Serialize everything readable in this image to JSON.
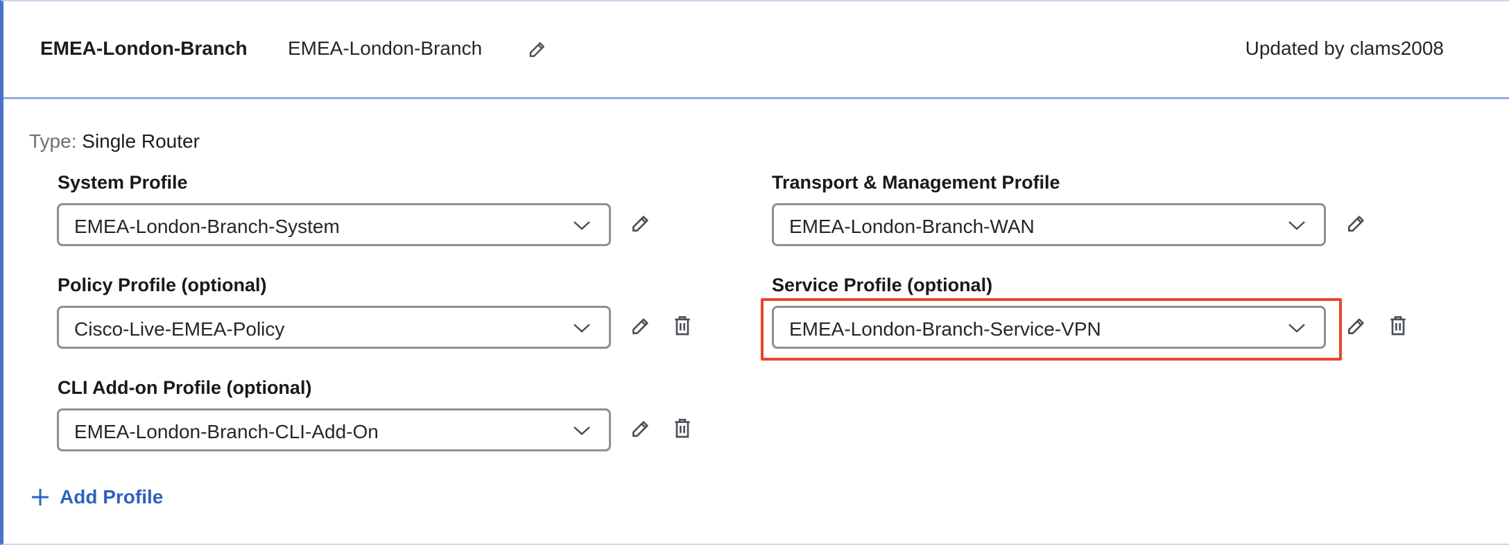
{
  "header": {
    "title": "EMEA-London-Branch",
    "name_value": "EMEA-London-Branch",
    "updated_by": "Updated by clams2008"
  },
  "type": {
    "label": "Type:",
    "value": "Single Router"
  },
  "profiles": {
    "system": {
      "label": "System Profile",
      "value": "EMEA-London-Branch-System"
    },
    "transport": {
      "label": "Transport & Management Profile",
      "value": "EMEA-London-Branch-WAN"
    },
    "policy": {
      "label": "Policy Profile (optional)",
      "value": "Cisco-Live-EMEA-Policy"
    },
    "service": {
      "label": "Service Profile (optional)",
      "value": "EMEA-London-Branch-Service-VPN"
    },
    "cli": {
      "label": "CLI Add-on Profile (optional)",
      "value": "EMEA-London-Branch-CLI-Add-On"
    }
  },
  "actions": {
    "add_profile": "Add Profile"
  },
  "colors": {
    "accent": "#2f61c4",
    "highlight": "#e8452c",
    "border": "#8a8f97"
  }
}
